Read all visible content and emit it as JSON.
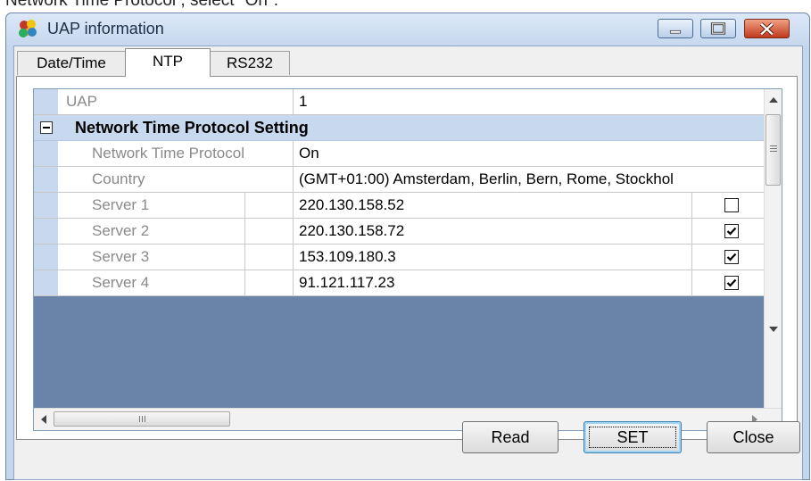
{
  "caption": "Network Time Protocol , select \"On\".",
  "window": {
    "title": "UAP information"
  },
  "tabs": [
    "Date/Time",
    "NTP",
    "RS232"
  ],
  "active_tab": "NTP",
  "grid": {
    "uap": {
      "label": "UAP",
      "value": "1"
    },
    "category": {
      "title": "Network Time Protocol Setting",
      "expanded": true
    },
    "ntp": {
      "label": "Network Time Protocol",
      "value": "On"
    },
    "country": {
      "label": "Country",
      "value": "(GMT+01:00) Amsterdam, Berlin, Bern, Rome, Stockhol"
    },
    "servers": [
      {
        "label": "Server 1",
        "value": "220.130.158.52",
        "checked": false
      },
      {
        "label": "Server 2",
        "value": "220.130.158.72",
        "checked": true
      },
      {
        "label": "Server 3",
        "value": "153.109.180.3",
        "checked": true
      },
      {
        "label": "Server 4",
        "value": "91.121.117.23",
        "checked": true
      }
    ]
  },
  "buttons": {
    "read": "Read",
    "set": "SET",
    "close": "Close"
  },
  "colors": {
    "category_band": "#c7d8ef",
    "grid_border": "#7f9db9",
    "title_bar": "#c6d8ef"
  }
}
